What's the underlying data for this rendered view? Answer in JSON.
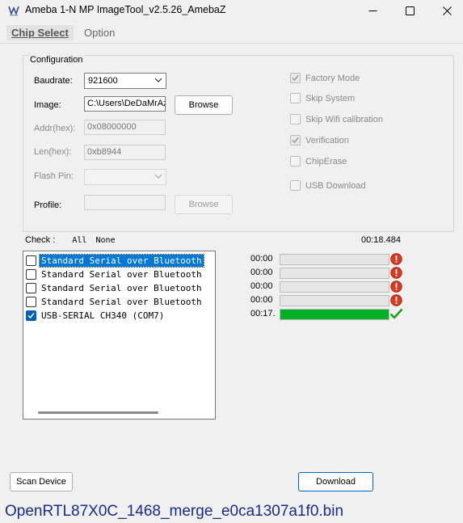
{
  "window": {
    "title": "Ameba 1-N MP ImageTool_v2.5.26_AmebaZ",
    "icon": "app-logo-icon",
    "controls": [
      "minimize-icon",
      "maximize-icon",
      "close-icon"
    ]
  },
  "menu": [
    {
      "label": "Chip Select",
      "active": true
    },
    {
      "label": "Option",
      "active": false
    }
  ],
  "config": {
    "legend": "Configuration",
    "baudrate": {
      "label": "Baudrate:",
      "value": "921600"
    },
    "image": {
      "label": "Image:",
      "value": "C:\\Users\\DeDaMrAz",
      "browse": "Browse"
    },
    "addr": {
      "label": "Addr(hex):",
      "value": "0x08000000"
    },
    "len": {
      "label": "Len(hex):",
      "value": "0xb8944"
    },
    "flash_pin": {
      "label": "Flash Pin:",
      "value": ""
    },
    "profile": {
      "label": "Profile:",
      "value": "",
      "browse": "Browse"
    },
    "options": [
      {
        "label": "Factory Mode",
        "checked": true
      },
      {
        "label": "Skip System",
        "checked": false
      },
      {
        "label": "Skip Wifi calibration",
        "checked": false
      },
      {
        "label": "Verification",
        "checked": true
      },
      {
        "label": "ChipErase",
        "checked": false
      },
      {
        "label": "USB Download",
        "checked": false
      }
    ]
  },
  "check": {
    "label": "Check :",
    "all": "All",
    "none": "None"
  },
  "elapsed": "00:18.484",
  "devices": [
    {
      "label": "Standard Serial over Bluetooth",
      "checked": false,
      "selected": true,
      "time": "00:00",
      "progress": 0,
      "status_icon": "error-icon"
    },
    {
      "label": "Standard Serial over Bluetooth",
      "checked": false,
      "selected": false,
      "time": "00:00",
      "progress": 0,
      "status_icon": "error-icon"
    },
    {
      "label": "Standard Serial over Bluetooth",
      "checked": false,
      "selected": false,
      "time": "00:00",
      "progress": 0,
      "status_icon": "error-icon"
    },
    {
      "label": "Standard Serial over Bluetooth",
      "checked": false,
      "selected": false,
      "time": "00:00",
      "progress": 0,
      "status_icon": "error-icon"
    },
    {
      "label": "USB-SERIAL CH340 (COM7)",
      "checked": true,
      "selected": false,
      "time": "00:17.",
      "progress": 1.0,
      "status_icon": "checkmark-icon"
    }
  ],
  "buttons": {
    "scan": "Scan Device",
    "download": "Download"
  },
  "status_filename": "OpenRTL87X0C_1468_merge_e0ca1307a1f0.bin",
  "colors": {
    "progress_fill": "#06b025",
    "error": "#d9391f",
    "success": "#1fa01f",
    "accent": "#0067c0",
    "filename": "#1a2b8c"
  }
}
